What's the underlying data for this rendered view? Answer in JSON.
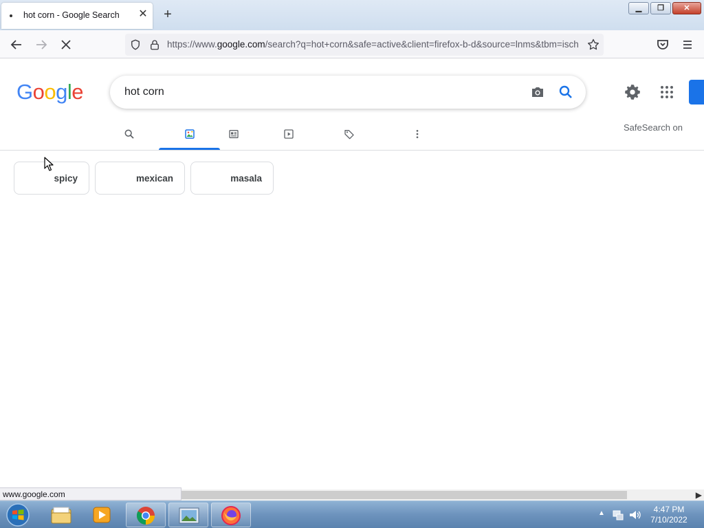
{
  "browser": {
    "tab_title": "hot corn - Google Search",
    "new_tab_glyph": "+",
    "close_tab_glyph": "✕",
    "url_prefix": "https://www.",
    "url_host": "google.com",
    "url_rest": "/search?q=hot+corn&safe=active&client=firefox-b-d&source=lnms&tbm=isch",
    "status_text": "www.google.com",
    "icons": [
      "back-icon",
      "forward-icon",
      "reload-icon",
      "shield-icon",
      "lock-icon",
      "bookmark-star-icon",
      "pocket-icon",
      "menu-icon"
    ]
  },
  "google": {
    "logo_letters": [
      "G",
      "o",
      "o",
      "g",
      "l",
      "e"
    ],
    "logo_colors": [
      "#4285F4",
      "#EA4335",
      "#FBBC05",
      "#4285F4",
      "#34A853",
      "#EA4335"
    ],
    "query": "hot corn",
    "safesearch_label": "SafeSearch on",
    "accent": "#1a73e8",
    "tabs": [
      {
        "icon": "search-icon",
        "active": false
      },
      {
        "icon": "image-icon",
        "active": true
      },
      {
        "icon": "news-icon",
        "active": false
      },
      {
        "icon": "video-icon",
        "active": false
      },
      {
        "icon": "tag-icon",
        "active": false
      },
      {
        "icon": "more-vert-icon",
        "active": false
      }
    ],
    "chips": [
      "spicy",
      "mexican",
      "masala"
    ]
  },
  "taskbar": {
    "time": "4:47 PM",
    "date": "7/10/2022",
    "apps": [
      "windows-explorer-icon",
      "media-player-icon",
      "chrome-icon",
      "photo-viewer-icon",
      "firefox-icon"
    ]
  }
}
